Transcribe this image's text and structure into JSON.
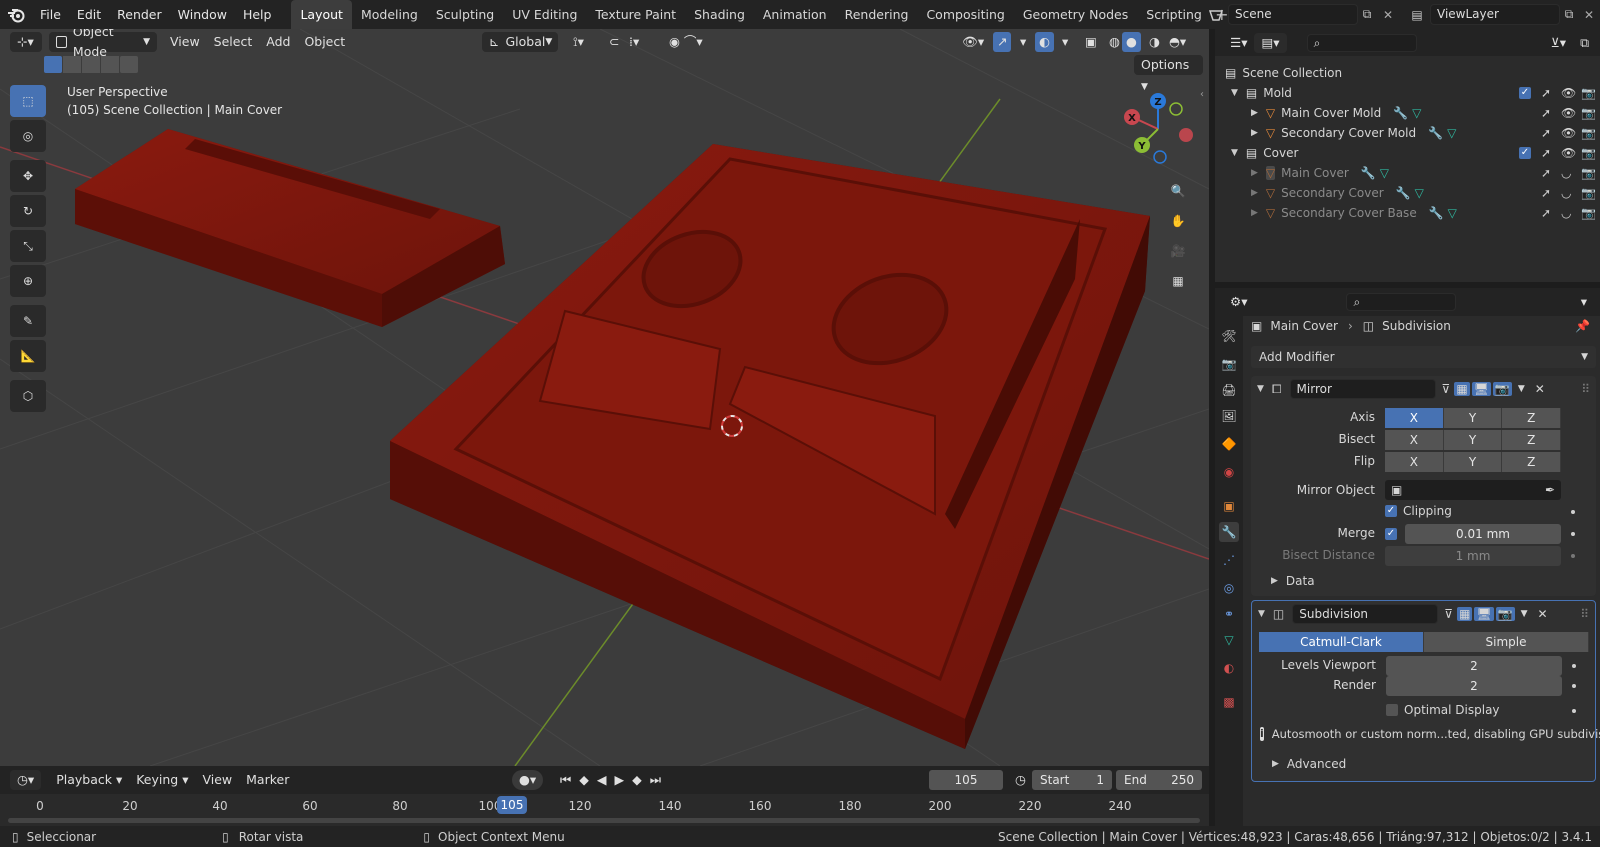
{
  "menu": {
    "file": "File",
    "edit": "Edit",
    "render": "Render",
    "window": "Window",
    "help": "Help"
  },
  "workspaces": [
    "Layout",
    "Modeling",
    "Sculpting",
    "UV Editing",
    "Texture Paint",
    "Shading",
    "Animation",
    "Rendering",
    "Compositing",
    "Geometry Nodes",
    "Scripting"
  ],
  "scene": {
    "name": "Scene",
    "view_layer": "ViewLayer"
  },
  "viewport": {
    "mode": "Object Mode",
    "view": "View",
    "select": "Select",
    "add": "Add",
    "object": "Object",
    "transform": "Global",
    "options": "Options",
    "perspective": "User Perspective",
    "context": "(105) Scene Collection | Main Cover",
    "gizmo": {
      "x": "X",
      "y": "Y",
      "z": "Z"
    }
  },
  "timeline": {
    "playback": "Playback",
    "keying": "Keying",
    "view": "View",
    "marker": "Marker",
    "current_frame": "105",
    "start_label": "Start",
    "start": "1",
    "end_label": "End",
    "end": "250",
    "ticks": [
      "0",
      "20",
      "40",
      "60",
      "80",
      "100",
      "120",
      "140",
      "160",
      "180",
      "200",
      "220",
      "240"
    ],
    "playhead": "105"
  },
  "status": {
    "select": "Seleccionar",
    "rotate": "Rotar vista",
    "context_menu": "Object Context Menu",
    "stats": "Scene Collection | Main Cover | Vértices:48,923 | Caras:48,656 | Triáng:97,312 | Objetos:0/2 | 3.4.1"
  },
  "outliner": {
    "root": "Scene Collection",
    "items": [
      {
        "label": "Mold"
      },
      {
        "label": "Main Cover Mold"
      },
      {
        "label": "Secondary Cover Mold"
      },
      {
        "label": "Cover"
      },
      {
        "label": "Main Cover"
      },
      {
        "label": "Secondary Cover"
      },
      {
        "label": "Secondary Cover Base"
      }
    ]
  },
  "properties": {
    "breadcrumb_object": "Main Cover",
    "breadcrumb_modifier": "Subdivision",
    "add_modifier": "Add Modifier",
    "mirror": {
      "name": "Mirror",
      "axis_label": "Axis",
      "bisect_label": "Bisect",
      "flip_label": "Flip",
      "x": "X",
      "y": "Y",
      "z": "Z",
      "mirror_object_label": "Mirror Object",
      "clipping": "Clipping",
      "merge_label": "Merge",
      "merge_value": "0.01 mm",
      "bisect_distance_label": "Bisect Distance",
      "bisect_distance_value": "1 mm",
      "data": "Data"
    },
    "subdivision": {
      "name": "Subdivision",
      "catmull": "Catmull-Clark",
      "simple": "Simple",
      "levels_label": "Levels Viewport",
      "levels": "2",
      "render_label": "Render",
      "render": "2",
      "optimal": "Optimal Display",
      "warning": "Autosmooth or custom norm...ted, disabling GPU subdivision",
      "advanced": "Advanced"
    }
  },
  "colors": {
    "accent": "#4772b3",
    "mesh": "#7a150c",
    "x_axis": "#c8474f",
    "y_axis": "#8cbd35",
    "z_axis": "#2a79d9"
  }
}
